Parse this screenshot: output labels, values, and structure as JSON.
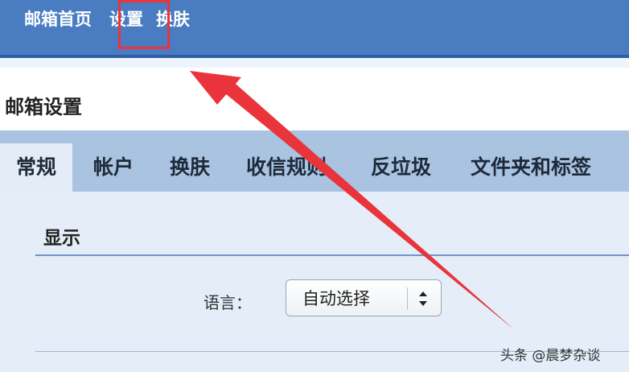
{
  "topnav": {
    "items": [
      "邮箱首页",
      "设置",
      "换肤"
    ]
  },
  "page": {
    "title": "邮箱设置"
  },
  "tabs": [
    {
      "label": "常规",
      "active": true
    },
    {
      "label": "帐户",
      "active": false
    },
    {
      "label": "换肤",
      "active": false
    },
    {
      "label": "收信规则",
      "active": false
    },
    {
      "label": "反垃圾",
      "active": false
    },
    {
      "label": "文件夹和标签",
      "active": false
    }
  ],
  "display_section": {
    "title": "显示",
    "language_label": "语言：",
    "language_value": "自动选择"
  },
  "watermark": "头条 @晨梦杂谈",
  "colors": {
    "topbar": "#4a7cc2",
    "tabstrip": "#a9c3e1",
    "highlight": "#e8343a"
  }
}
